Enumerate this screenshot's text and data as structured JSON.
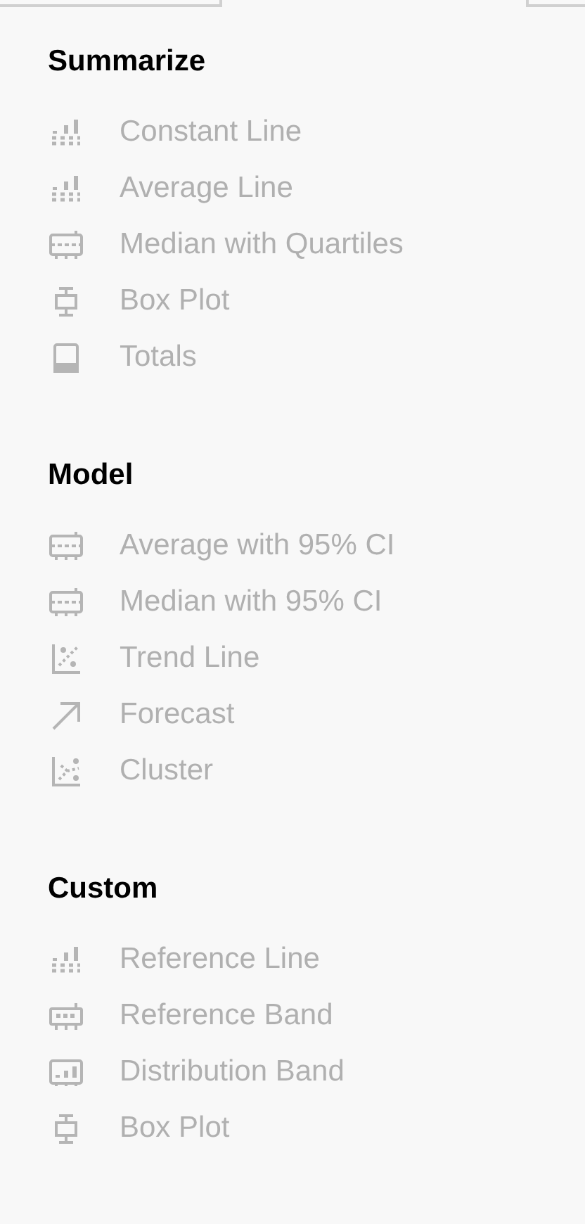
{
  "sections": [
    {
      "title": "Summarize",
      "items": [
        {
          "label": "Constant Line",
          "kind": "bars",
          "disabled": true
        },
        {
          "label": "Average Line",
          "kind": "bars",
          "disabled": true
        },
        {
          "label": "Median with Quartiles",
          "kind": "band",
          "disabled": true
        },
        {
          "label": "Box Plot",
          "kind": "boxplot",
          "disabled": true
        },
        {
          "label": "Totals",
          "kind": "totals",
          "disabled": true
        }
      ]
    },
    {
      "title": "Model",
      "items": [
        {
          "label": "Average with 95% CI",
          "kind": "band",
          "disabled": true
        },
        {
          "label": "Median with 95% CI",
          "kind": "band",
          "disabled": true
        },
        {
          "label": "Trend Line",
          "kind": "trend",
          "disabled": true
        },
        {
          "label": "Forecast",
          "kind": "forecast",
          "disabled": true
        },
        {
          "label": "Cluster",
          "kind": "cluster",
          "disabled": true
        }
      ]
    },
    {
      "title": "Custom",
      "items": [
        {
          "label": "Reference Line",
          "kind": "bars",
          "disabled": true
        },
        {
          "label": "Reference Band",
          "kind": "refband",
          "disabled": true
        },
        {
          "label": "Distribution Band",
          "kind": "distband",
          "disabled": true
        },
        {
          "label": "Box Plot",
          "kind": "boxplot",
          "disabled": true
        }
      ]
    }
  ]
}
